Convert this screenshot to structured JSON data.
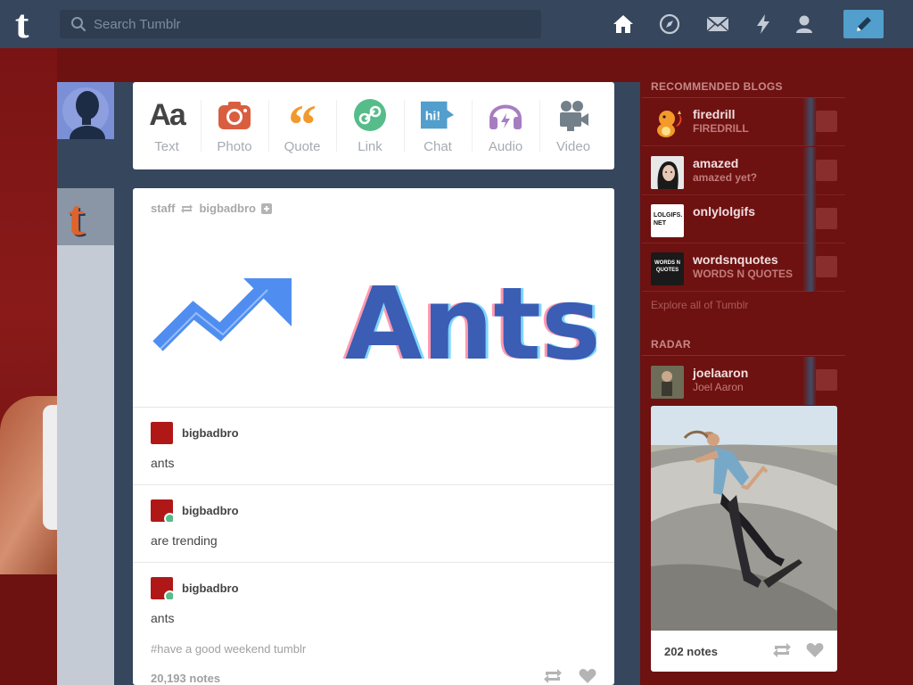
{
  "topbar": {
    "logo": "t",
    "search_placeholder": "Search Tumblr",
    "nav_icons": [
      "home-icon",
      "explore-icon",
      "inbox-icon",
      "activity-icon",
      "account-icon"
    ],
    "compose_icon": "pencil-icon"
  },
  "post_types": [
    {
      "label": "Text",
      "icon": "text-icon",
      "color": "#444444"
    },
    {
      "label": "Photo",
      "icon": "camera-icon",
      "color": "#d95e40"
    },
    {
      "label": "Quote",
      "icon": "quote-icon",
      "color": "#f2992e"
    },
    {
      "label": "Link",
      "icon": "link-icon",
      "color": "#56bc8a"
    },
    {
      "label": "Chat",
      "icon": "chat-icon",
      "color": "#529ecc"
    },
    {
      "label": "Audio",
      "icon": "headphones-icon",
      "color": "#a77dc2"
    },
    {
      "label": "Video",
      "icon": "video-camera-icon",
      "color": "#748089"
    }
  ],
  "post": {
    "author": "staff",
    "reblogged_from": "bigbadbro",
    "image_text": "Ants",
    "chat": [
      {
        "user": "bigbadbro",
        "message": "ants",
        "reblog_badge": false
      },
      {
        "user": "bigbadbro",
        "message": "are trending",
        "reblog_badge": true
      },
      {
        "user": "bigbadbro",
        "message": "ants",
        "reblog_badge": true
      }
    ],
    "tags": "#have a good weekend tumblr",
    "notes": "20,193 notes"
  },
  "sidebar": {
    "recommended_heading": "RECOMMENDED BLOGS",
    "blogs": [
      {
        "name": "firedrill",
        "subtitle": "FIREDRILL"
      },
      {
        "name": "amazed",
        "subtitle": "amazed yet?"
      },
      {
        "name": "onlylolgifs",
        "subtitle": "",
        "avatar_text": "LOLGIFS. NET"
      },
      {
        "name": "wordsnquotes",
        "subtitle": "WORDS N QUOTES",
        "avatar_text": "WORDS N QUOTES"
      }
    ],
    "explore_link": "Explore all of Tumblr",
    "radar_heading": "RADAR",
    "radar": {
      "name": "joelaaron",
      "subtitle": "Joel Aaron",
      "notes": "202 notes"
    }
  },
  "colors": {
    "background": "#6e1111",
    "nav": "#36465d",
    "accent": "#529ecc"
  }
}
